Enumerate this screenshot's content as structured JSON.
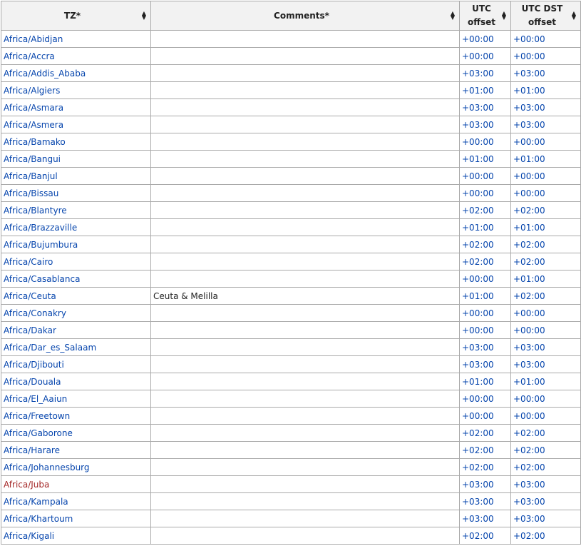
{
  "headers": [
    {
      "label": "TZ*"
    },
    {
      "label": "Comments*"
    },
    {
      "label": "UTC offset"
    },
    {
      "label": "UTC DST offset"
    }
  ],
  "rows": [
    {
      "tz": "Africa/Abidjan",
      "comment": "",
      "utc": "+00:00",
      "dst": "+00:00"
    },
    {
      "tz": "Africa/Accra",
      "comment": "",
      "utc": "+00:00",
      "dst": "+00:00"
    },
    {
      "tz": "Africa/Addis_Ababa",
      "comment": "",
      "utc": "+03:00",
      "dst": "+03:00"
    },
    {
      "tz": "Africa/Algiers",
      "comment": "",
      "utc": "+01:00",
      "dst": "+01:00"
    },
    {
      "tz": "Africa/Asmara",
      "comment": "",
      "utc": "+03:00",
      "dst": "+03:00"
    },
    {
      "tz": "Africa/Asmera",
      "comment": "",
      "utc": "+03:00",
      "dst": "+03:00"
    },
    {
      "tz": "Africa/Bamako",
      "comment": "",
      "utc": "+00:00",
      "dst": "+00:00"
    },
    {
      "tz": "Africa/Bangui",
      "comment": "",
      "utc": "+01:00",
      "dst": "+01:00"
    },
    {
      "tz": "Africa/Banjul",
      "comment": "",
      "utc": "+00:00",
      "dst": "+00:00"
    },
    {
      "tz": "Africa/Bissau",
      "comment": "",
      "utc": "+00:00",
      "dst": "+00:00"
    },
    {
      "tz": "Africa/Blantyre",
      "comment": "",
      "utc": "+02:00",
      "dst": "+02:00"
    },
    {
      "tz": "Africa/Brazzaville",
      "comment": "",
      "utc": "+01:00",
      "dst": "+01:00"
    },
    {
      "tz": "Africa/Bujumbura",
      "comment": "",
      "utc": "+02:00",
      "dst": "+02:00"
    },
    {
      "tz": "Africa/Cairo",
      "comment": "",
      "utc": "+02:00",
      "dst": "+02:00"
    },
    {
      "tz": "Africa/Casablanca",
      "comment": "",
      "utc": "+00:00",
      "dst": "+01:00"
    },
    {
      "tz": "Africa/Ceuta",
      "comment": "Ceuta & Melilla",
      "utc": "+01:00",
      "dst": "+02:00"
    },
    {
      "tz": "Africa/Conakry",
      "comment": "",
      "utc": "+00:00",
      "dst": "+00:00"
    },
    {
      "tz": "Africa/Dakar",
      "comment": "",
      "utc": "+00:00",
      "dst": "+00:00"
    },
    {
      "tz": "Africa/Dar_es_Salaam",
      "comment": "",
      "utc": "+03:00",
      "dst": "+03:00"
    },
    {
      "tz": "Africa/Djibouti",
      "comment": "",
      "utc": "+03:00",
      "dst": "+03:00"
    },
    {
      "tz": "Africa/Douala",
      "comment": "",
      "utc": "+01:00",
      "dst": "+01:00"
    },
    {
      "tz": "Africa/El_Aaiun",
      "comment": "",
      "utc": "+00:00",
      "dst": "+00:00"
    },
    {
      "tz": "Africa/Freetown",
      "comment": "",
      "utc": "+00:00",
      "dst": "+00:00"
    },
    {
      "tz": "Africa/Gaborone",
      "comment": "",
      "utc": "+02:00",
      "dst": "+02:00"
    },
    {
      "tz": "Africa/Harare",
      "comment": "",
      "utc": "+02:00",
      "dst": "+02:00"
    },
    {
      "tz": "Africa/Johannesburg",
      "comment": "",
      "utc": "+02:00",
      "dst": "+02:00"
    },
    {
      "tz": "Africa/Juba",
      "comment": "",
      "utc": "+03:00",
      "dst": "+03:00",
      "link_color": "#a52a2a"
    },
    {
      "tz": "Africa/Kampala",
      "comment": "",
      "utc": "+03:00",
      "dst": "+03:00"
    },
    {
      "tz": "Africa/Khartoum",
      "comment": "",
      "utc": "+03:00",
      "dst": "+03:00"
    },
    {
      "tz": "Africa/Kigali",
      "comment": "",
      "utc": "+02:00",
      "dst": "+02:00"
    }
  ],
  "colors": {
    "link": "#0645ad",
    "new_link": "#a52a2a",
    "header_bg": "#f2f2f2",
    "border": "#aaaaaa"
  },
  "icons": {
    "sort": "sort-icon"
  }
}
